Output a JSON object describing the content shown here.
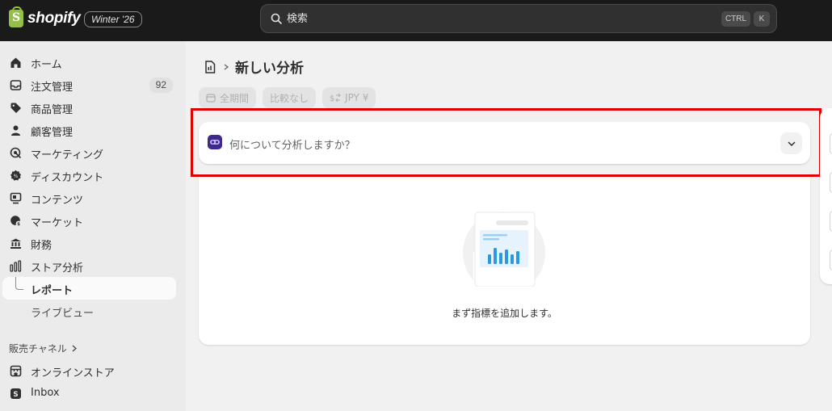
{
  "topbar": {
    "brand": "shopify",
    "edition": "Winter '26",
    "search_placeholder": "検索",
    "shortcut_ctrl": "CTRL",
    "shortcut_k": "K"
  },
  "sidebar": {
    "items": [
      {
        "label": "ホーム",
        "icon": "home-icon"
      },
      {
        "label": "注文管理",
        "icon": "inbox-icon",
        "badge": "92"
      },
      {
        "label": "商品管理",
        "icon": "tag-icon"
      },
      {
        "label": "顧客管理",
        "icon": "person-icon"
      },
      {
        "label": "マーケティング",
        "icon": "target-icon"
      },
      {
        "label": "ディスカウント",
        "icon": "discount-icon"
      },
      {
        "label": "コンテンツ",
        "icon": "content-icon"
      },
      {
        "label": "マーケット",
        "icon": "globe-icon"
      },
      {
        "label": "財務",
        "icon": "bank-icon"
      },
      {
        "label": "ストア分析",
        "icon": "chart-icon"
      },
      {
        "label": "レポート",
        "icon": "",
        "active": true
      },
      {
        "label": "ライブビュー",
        "icon": ""
      }
    ],
    "channels_title": "販売チャネル",
    "channels": [
      {
        "label": "オンラインストア",
        "icon": "store-icon"
      },
      {
        "label": "Inbox",
        "icon": "inbox-chat-icon"
      }
    ]
  },
  "main": {
    "title": "新しい分析",
    "filters": {
      "period": "全期間",
      "compare": "比較なし",
      "currency": "JPY ¥"
    },
    "ask_placeholder": "何について分析しますか？",
    "empty_message": "まず指標を追加します。"
  },
  "colors": {
    "highlight": "#e00000",
    "brand_green": "#95bf47",
    "chart_blue": "#2a9ae0"
  }
}
